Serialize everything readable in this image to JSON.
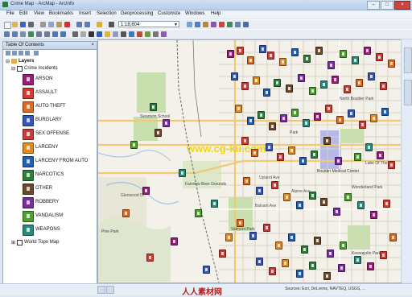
{
  "window": {
    "title": "Crime Map - ArcMap - ArcInfo"
  },
  "menu": [
    "File",
    "Edit",
    "View",
    "Bookmarks",
    "Insert",
    "Selection",
    "Geoprocessing",
    "Customize",
    "Windows",
    "Help"
  ],
  "toolbar": {
    "scale": "1:18,604"
  },
  "toc": {
    "header": "Table Of Contents",
    "close": "×",
    "root": "Layers",
    "group": "Crime Incidents",
    "basemap": "World Topo Map",
    "legend": [
      {
        "label": "ARSON",
        "color": "#9b1d7a"
      },
      {
        "label": "ASSAULT",
        "color": "#d63a2f"
      },
      {
        "label": "AUTO THEFT",
        "color": "#e06b1c"
      },
      {
        "label": "BURGLARY",
        "color": "#3457b8"
      },
      {
        "label": "SEX OFFENSE",
        "color": "#cc3a3a"
      },
      {
        "label": "LARCENY",
        "color": "#e08a1f"
      },
      {
        "label": "LARCENY FROM AUTO",
        "color": "#1f5fb5"
      },
      {
        "label": "NARCOTICS",
        "color": "#2f7f3a"
      },
      {
        "label": "OTHER",
        "color": "#6b4a2a"
      },
      {
        "label": "ROBBERY",
        "color": "#7b2ea0"
      },
      {
        "label": "VANDALISM",
        "color": "#4da12f"
      },
      {
        "label": "WEAPONS",
        "color": "#2c8a7a"
      }
    ]
  },
  "map": {
    "labels": {
      "school": "Swanson School",
      "park": "Park",
      "grounds": "Fairview Beer Grounds",
      "hospital": "Boulder Medical Center",
      "ave1": "Upland Ave",
      "ave2": "Alpine Ave",
      "ave3": "Balsam Ave",
      "ave4": "Glenwood Dr",
      "park2": "Valmont Park",
      "park3": "Keewaydin Park",
      "lake": "Lake Of The Isle",
      "n_park": "North Boulder Park",
      "pine": "Pine Park",
      "water": "Wonderland Park"
    },
    "watermark": "www.cg-ku.com",
    "credit": "Sources: Esri, DeLorme, NAVTEQ, USGS, ...",
    "bottom_logo": "人人素材网"
  },
  "status": {
    "coords": ""
  }
}
